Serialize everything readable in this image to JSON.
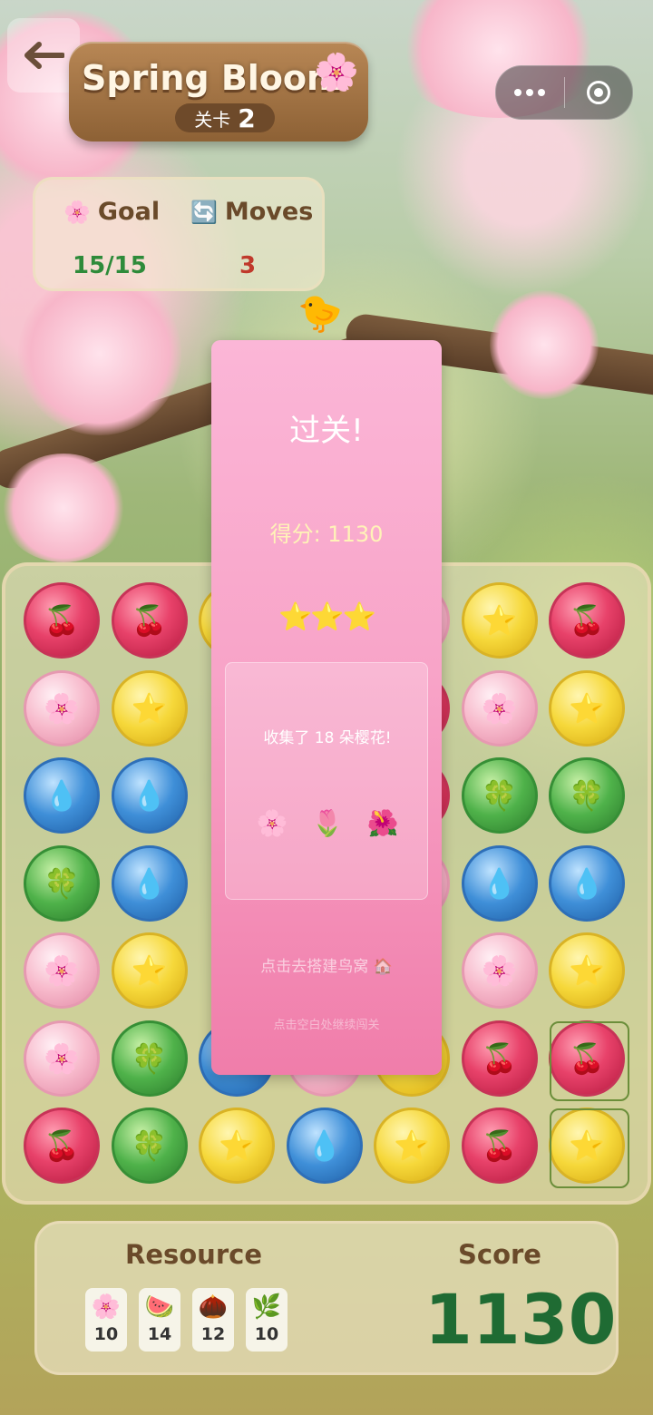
{
  "header": {
    "back_icon": "arrow-left-icon",
    "title": "Spring Bloom",
    "title_icon": "cherry-blossom-icon",
    "level_label": "关卡",
    "level_number": "2",
    "menu_icon": "more-dots-icon",
    "close_icon": "target-circle-icon"
  },
  "stats": {
    "goal_label": "Goal",
    "goal_icon": "🌸",
    "goal_value": "15/15",
    "moves_label": "Moves",
    "moves_icon": "🔄",
    "moves_value": "3"
  },
  "board": {
    "rows": [
      [
        "red",
        "red",
        "yellow",
        "",
        "pink",
        "yellow",
        "red"
      ],
      [
        "pink",
        "yellow",
        "",
        "",
        "red",
        "pink",
        "yellow"
      ],
      [
        "blue",
        "blue",
        "",
        "",
        "red",
        "green",
        "green"
      ],
      [
        "green",
        "blue",
        "",
        "",
        "pink",
        "blue",
        "blue"
      ],
      [
        "pink",
        "yellow",
        "",
        "",
        "",
        "pink",
        "yellow"
      ],
      [
        "pink",
        "green",
        "blue",
        "pink",
        "yellow",
        "red",
        "red"
      ],
      [
        "red",
        "green",
        "yellow",
        "blue",
        "yellow",
        "red",
        "yellow"
      ]
    ],
    "tile_symbols": {
      "red": "🍒",
      "pink": "🌸",
      "yellow": "⭐",
      "blue": "💧",
      "green": "🍀"
    }
  },
  "resources": {
    "label": "Resource",
    "items": [
      {
        "icon": "🌸",
        "count": "10"
      },
      {
        "icon": "🍉",
        "count": "14"
      },
      {
        "icon": "🌰",
        "count": "12"
      },
      {
        "icon": "🌿",
        "count": "10"
      }
    ]
  },
  "score": {
    "label": "Score",
    "value": "1130"
  },
  "modal": {
    "title": "过关!",
    "score_text": "得分: 1130",
    "stars": "⭐⭐⭐",
    "collected_text": "收集了 18 朵樱花!",
    "icons": [
      "🌸",
      "🌷",
      "🌺"
    ],
    "build_link": "点击去搭建鸟窝 🏠",
    "continue_hint": "点击空白处继续闯关"
  },
  "colors": {
    "modal_pink": "#f8a4c8",
    "score_green": "#1f6b33",
    "moves_red": "#c0392b",
    "goal_green": "#2e8b3a"
  }
}
